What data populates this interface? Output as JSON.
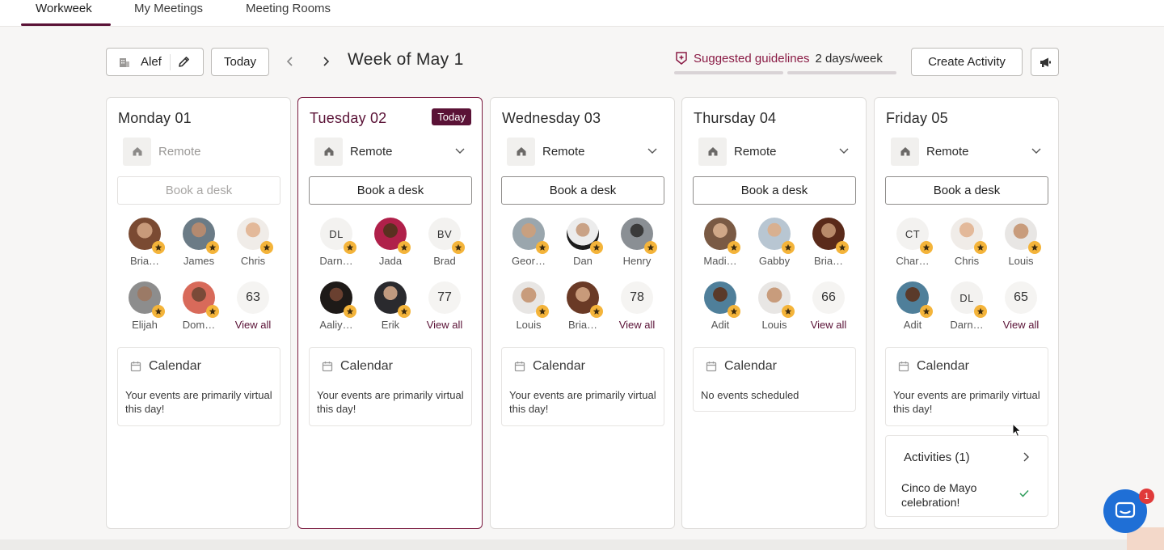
{
  "tabs": [
    {
      "label": "Workweek"
    },
    {
      "label": "My Meetings"
    },
    {
      "label": "Meeting Rooms"
    }
  ],
  "toolbar": {
    "office_label": "Alef",
    "today_label": "Today",
    "week_title": "Week of May 1",
    "guideline_label": "Suggested guidelines",
    "guideline_value": "2 days/week",
    "create_label": "Create Activity"
  },
  "days": [
    {
      "title": "Monday 01",
      "status": "Remote",
      "book_label": "Book a desk",
      "people": [
        {
          "name": "Bria…"
        },
        {
          "name": "James"
        },
        {
          "name": "Chris"
        },
        {
          "name": "Elijah"
        },
        {
          "name": "Dom…"
        }
      ],
      "count": "63",
      "view_all": "View all",
      "calendar_title": "Calendar",
      "calendar_text": "Your events are primarily virtual this day!"
    },
    {
      "title": "Tuesday 02",
      "badge": "Today",
      "status": "Remote",
      "book_label": "Book a desk",
      "people": [
        {
          "name": "Darn…",
          "initials": "DL"
        },
        {
          "name": "Jada"
        },
        {
          "name": "Brad",
          "initials": "BV"
        },
        {
          "name": "Aaliy…"
        },
        {
          "name": "Erik"
        }
      ],
      "count": "77",
      "view_all": "View all",
      "calendar_title": "Calendar",
      "calendar_text": "Your events are primarily virtual this day!"
    },
    {
      "title": "Wednesday 03",
      "status": "Remote",
      "book_label": "Book a desk",
      "people": [
        {
          "name": "Geor…"
        },
        {
          "name": "Dan"
        },
        {
          "name": "Henry"
        },
        {
          "name": "Louis"
        },
        {
          "name": "Bria…"
        }
      ],
      "count": "78",
      "view_all": "View all",
      "calendar_title": "Calendar",
      "calendar_text": "Your events are primarily virtual this day!"
    },
    {
      "title": "Thursday 04",
      "status": "Remote",
      "book_label": "Book a desk",
      "people": [
        {
          "name": "Madi…"
        },
        {
          "name": "Gabby"
        },
        {
          "name": "Bria…"
        },
        {
          "name": "Adit"
        },
        {
          "name": "Louis"
        }
      ],
      "count": "66",
      "view_all": "View all",
      "calendar_title": "Calendar",
      "calendar_text": "No events scheduled"
    },
    {
      "title": "Friday 05",
      "status": "Remote",
      "book_label": "Book a desk",
      "people": [
        {
          "name": "Char…",
          "initials": "CT"
        },
        {
          "name": "Chris"
        },
        {
          "name": "Louis"
        },
        {
          "name": "Adit"
        },
        {
          "name": "Darn…",
          "initials": "DL"
        }
      ],
      "count": "65",
      "view_all": "View all",
      "calendar_title": "Calendar",
      "calendar_text": "Your events are primarily virtual this day!",
      "activities_title": "Activities (1)",
      "activity_item": "Cinco de Mayo celebration!"
    }
  ],
  "chat": {
    "badge": "1"
  },
  "colors": {
    "accent": "#5a1236",
    "guideline": "#8a1b45",
    "star": "#f4b43a",
    "chat": "#1f6fd6",
    "check": "#2e9c5a"
  }
}
